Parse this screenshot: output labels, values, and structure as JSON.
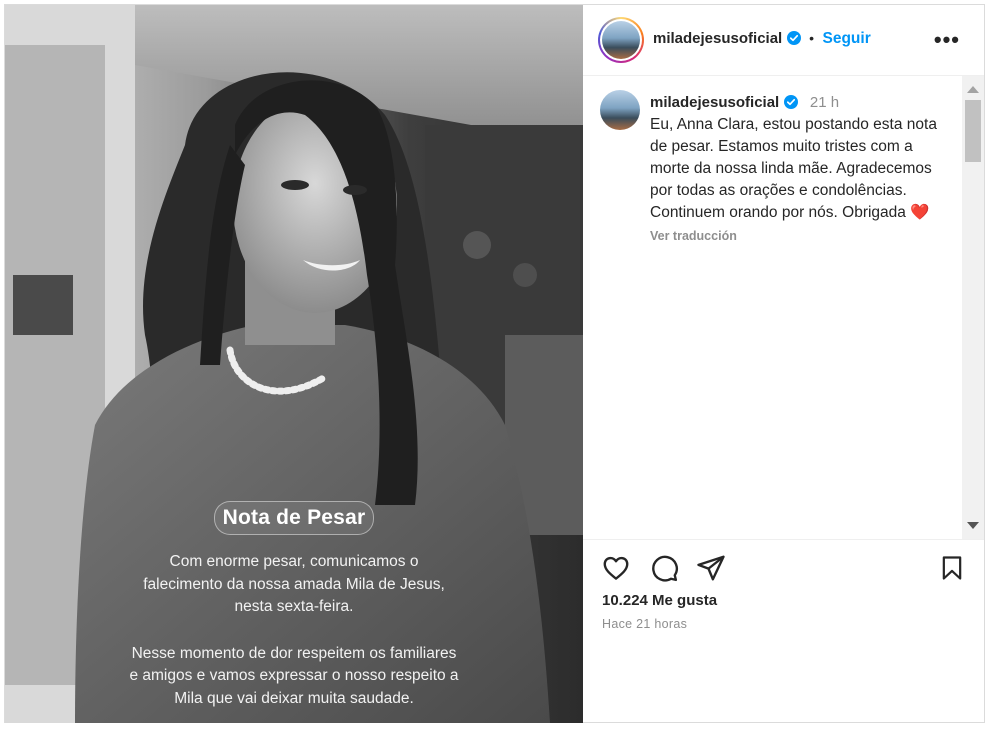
{
  "post": {
    "username": "miladejesusoficial",
    "follow_label": "Seguir",
    "separator": "•",
    "more_label": "•••"
  },
  "image_overlay": {
    "title": "Nota de Pesar",
    "paragraph1": [
      "Com enorme pesar, comunicamos o",
      "falecimento da nossa amada Mila de Jesus,",
      "nesta sexta-feira."
    ],
    "paragraph2": [
      "Nesse momento de dor respeitem os  familiares",
      "e amigos e vamos expressar o nosso respeito a",
      "Mila que vai deixar muita saudade."
    ]
  },
  "caption": {
    "username": "miladejesusoficial",
    "time": "21 h",
    "text": "Eu, Anna Clara, estou postando esta nota de pesar. Estamos muito tristes com a morte da nossa linda mãe. Agradecemos por todas as orações e condolências. Continuem orando por nós. Obrigada",
    "emoji": "❤️",
    "translate_label": "Ver traducción"
  },
  "stats": {
    "likes": "10.224 Me gusta",
    "posted_ago": "Hace 21 horas"
  },
  "icons": [
    "verified-badge-icon",
    "heart-icon",
    "comment-icon",
    "share-icon",
    "bookmark-icon",
    "more-options-icon"
  ],
  "colors": {
    "accent": "#0095f6",
    "verified": "#0095f6",
    "text": "#262626",
    "muted": "#8e8e8e",
    "heart": "#e0245e"
  }
}
